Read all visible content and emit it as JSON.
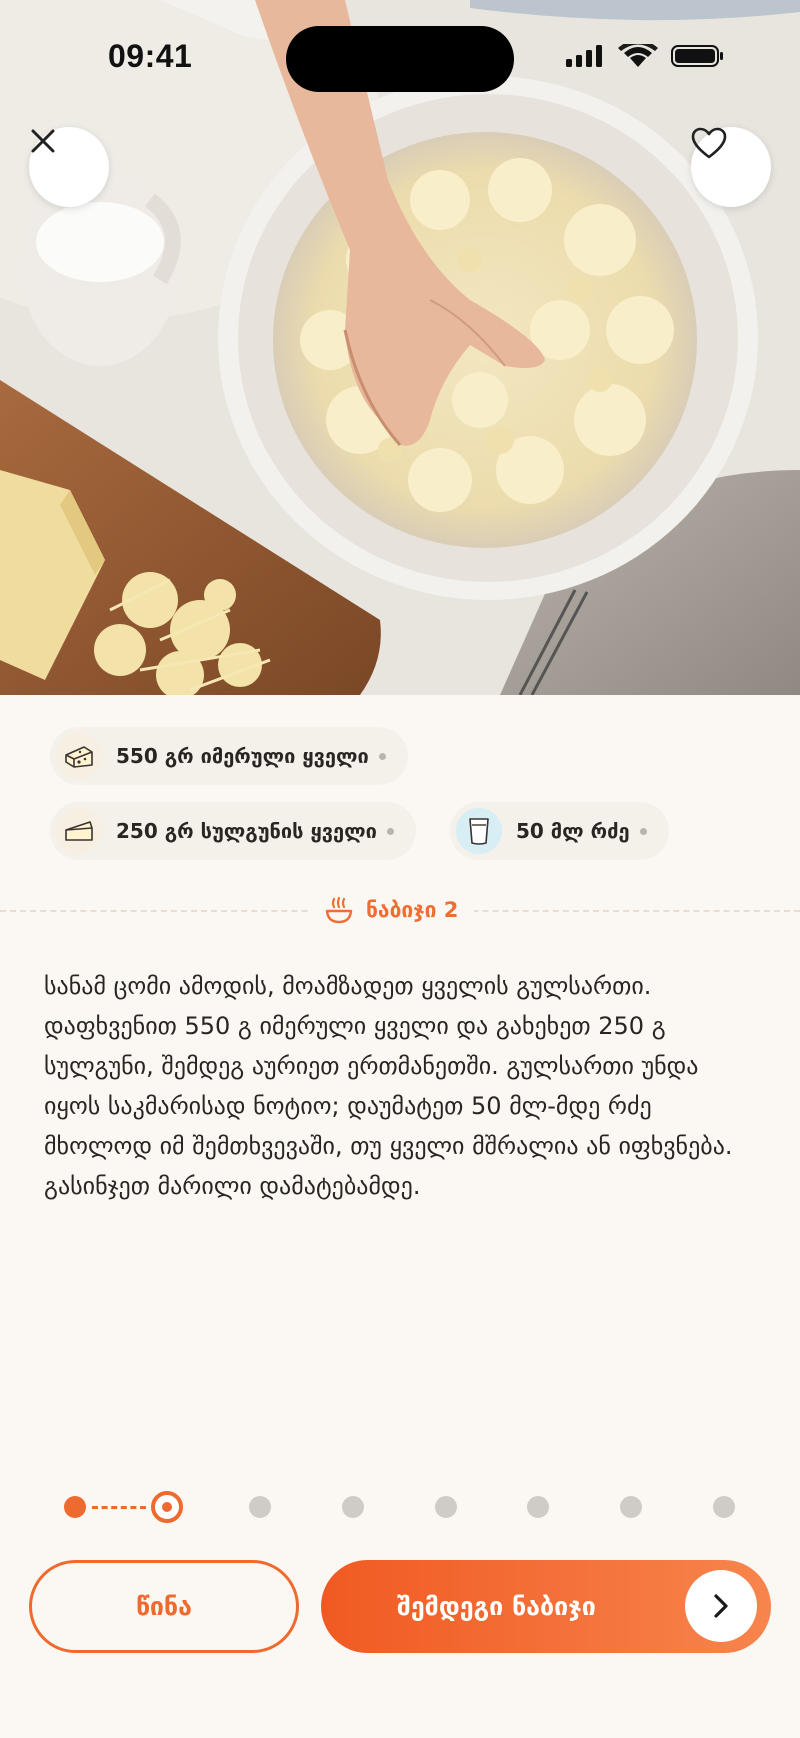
{
  "status_bar": {
    "time": "09:41"
  },
  "ingredients": [
    {
      "label": "550 გრ იმერული ყველი",
      "icon": "cheese-block-icon"
    },
    {
      "label": "250 გრ სულგუნის ყველი",
      "icon": "cheese-wedge-icon"
    },
    {
      "label": "50 მლ რძე",
      "icon": "milk-glass-icon"
    }
  ],
  "step": {
    "label": "ნაბიჯი 2",
    "text": "სანამ ცომი ამოდის, მოამზადეთ ყველის გულსართი. დაფხვენით 550 გ იმერული ყველი და გახეხეთ 250 გ სულგუნი, შემდეგ აურიეთ ერთმანეთში. გულსართი უნდა იყოს საკმარისად ნოტიო; დაუმატეთ 50 მლ-მდე რძე მხოლოდ იმ შემთხვევაში, თუ ყველი მშრალია ან იფხვნება. გასინჯეთ მარილი დამატებამდე."
  },
  "progress": {
    "total": 8,
    "current": 2
  },
  "buttons": {
    "prev_label": "წინა",
    "next_label": "შემდეგი ნაბიჯი"
  },
  "colors": {
    "accent": "#ef6a2e",
    "background": "#fbf8f3"
  }
}
